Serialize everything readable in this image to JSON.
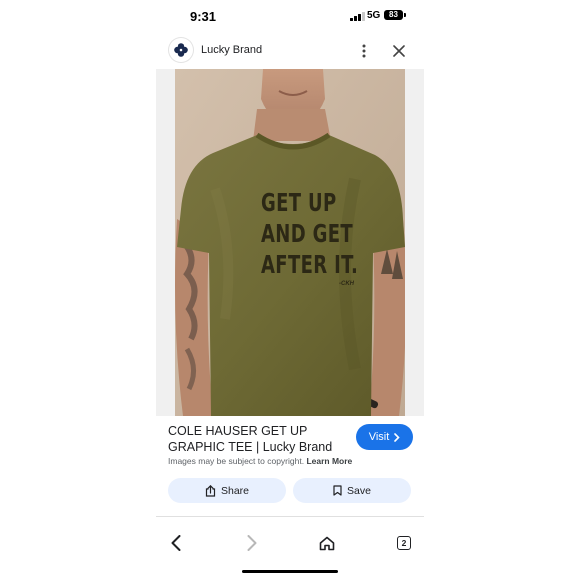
{
  "status_bar": {
    "time": "9:31",
    "network": "5G",
    "battery": "83"
  },
  "header": {
    "brand_name": "Lucky Brand",
    "logo_icon": "clover-icon",
    "more_icon": "more-vert-icon",
    "close_icon": "close-icon"
  },
  "image": {
    "shirt_lines": [
      "GET UP",
      "AND GET",
      "AFTER IT."
    ],
    "shirt_signature": "-CKH",
    "shirt_color": "#6e6a35",
    "background_color": "#cdb9a5"
  },
  "result": {
    "title": "COLE HAUSER GET UP GRAPHIC TEE | Lucky Brand",
    "visit_label": "Visit",
    "copyright_text": "Images may be subject to copyright.",
    "learn_more_label": "Learn More"
  },
  "actions": {
    "share_label": "Share",
    "save_label": "Save"
  },
  "nav": {
    "tabs_count": "2"
  },
  "colors": {
    "accent": "#1a73e8",
    "action_bg": "#e8f0fe",
    "brand_logo": "#1a2a4f"
  }
}
